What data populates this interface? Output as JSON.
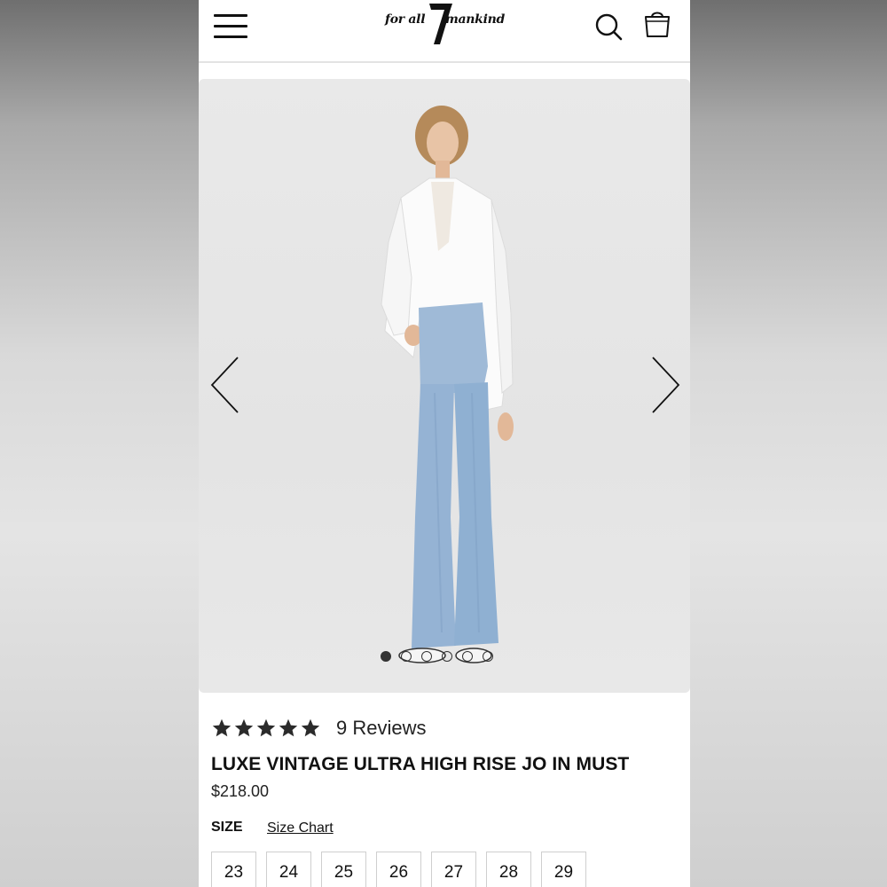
{
  "brand": {
    "logo_left_text": "for all",
    "logo_right_text": "mankind",
    "logo_numeral": "7"
  },
  "header": {
    "menu_icon": "hamburger-menu-icon",
    "search_icon": "search-icon",
    "bag_icon": "shopping-bag-icon"
  },
  "gallery": {
    "image_alt": "Model wearing white shirt and light wash wide-leg jeans",
    "prev_icon": "chevron-left-icon",
    "next_icon": "chevron-right-icon",
    "slide_count": 6,
    "active_slide": 1
  },
  "product": {
    "rating": 5,
    "rating_max": 5,
    "reviews_label": "9 Reviews",
    "title": "LUXE VINTAGE ULTRA HIGH RISE JO IN MUST",
    "price": "$218.00"
  },
  "size_selector": {
    "label": "SIZE",
    "chart_link": "Size Chart",
    "options": [
      "23",
      "24",
      "25",
      "26",
      "27",
      "28",
      "29"
    ]
  },
  "colors": {
    "text": "#111111",
    "star": "#2b2b2b",
    "border": "#cfcfcf",
    "image_bg": "#e6e6e6"
  }
}
